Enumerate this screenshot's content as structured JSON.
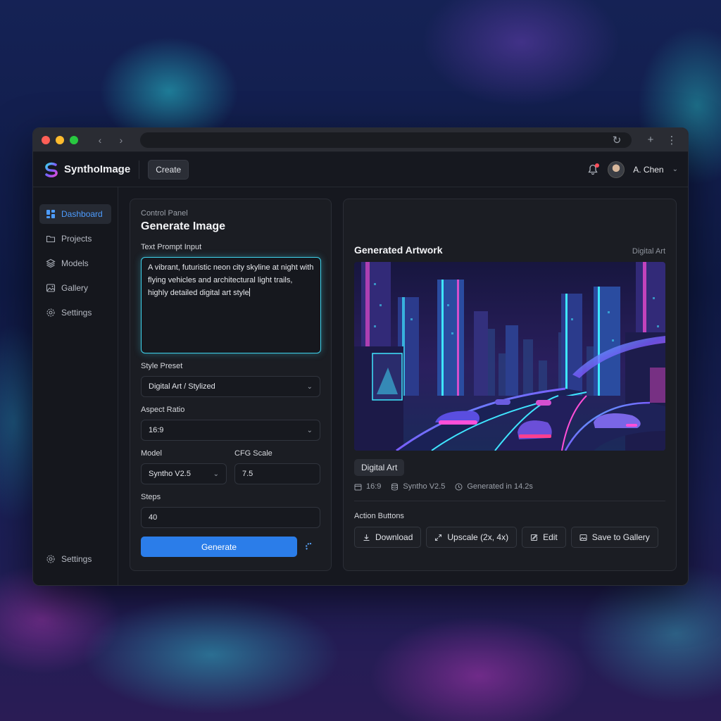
{
  "app": {
    "name": "SynthoImage",
    "create_label": "Create",
    "user_name": "A. Chen"
  },
  "sidebar": {
    "items": [
      {
        "label": "Dashboard",
        "icon": "dashboard-icon",
        "active": true
      },
      {
        "label": "Projects",
        "icon": "folder-icon"
      },
      {
        "label": "Models",
        "icon": "layers-icon"
      },
      {
        "label": "Gallery",
        "icon": "image-icon"
      },
      {
        "label": "Settings",
        "icon": "gear-icon"
      }
    ],
    "bottom_label": "Settings"
  },
  "control": {
    "eyebrow": "Control Panel",
    "title": "Generate Image",
    "prompt_label": "Text Prompt Input",
    "prompt_value": "A vibrant, futuristic neon city skyline at night with flying vehicles and architectural light trails, highly detailed digital art style",
    "style_label": "Style Preset",
    "style_value": "Digital Art / Stylized",
    "aspect_label": "Aspect Ratio",
    "aspect_value": "16:9",
    "model_label": "Model",
    "model_value": "Syntho V2.5",
    "cfg_label": "CFG Scale",
    "cfg_value": "7.5",
    "steps_label": "Steps",
    "steps_value": "40",
    "generate_label": "Generate"
  },
  "output": {
    "title": "Generated Artwork",
    "tag": "Digital Art",
    "chip": "Digital Art",
    "meta_ratio": "16:9",
    "meta_model": "Syntho V2.5",
    "meta_time": "Generated in 14.2s",
    "actions_label": "Action Buttons",
    "actions": {
      "download": "Download",
      "upscale": "Upscale (2x, 4x)",
      "edit": "Edit",
      "save": "Save to Gallery"
    }
  },
  "colors": {
    "accent": "#2b7de9",
    "focus": "#3fd4ee",
    "active_text": "#4d9cff"
  }
}
